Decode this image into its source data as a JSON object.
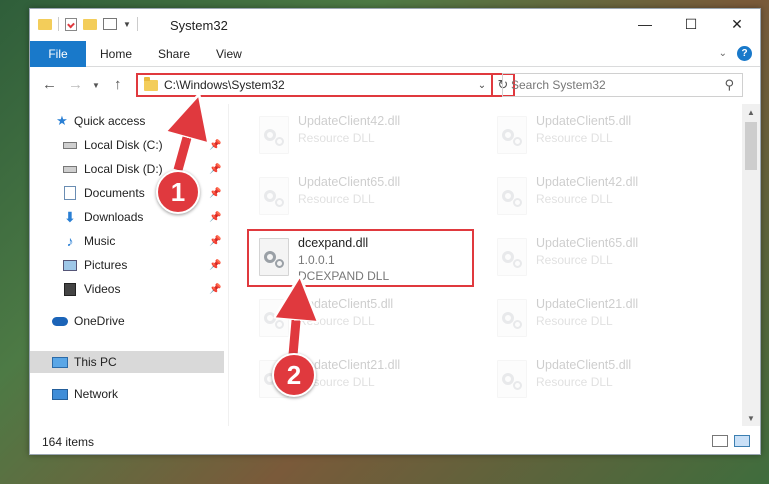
{
  "window": {
    "title": "System32",
    "controls": {
      "minimize": "—",
      "maximize": "☐",
      "close": "✕"
    }
  },
  "ribbon": {
    "tabs": [
      "File",
      "Home",
      "Share",
      "View"
    ]
  },
  "navigation": {
    "address": "C:\\Windows\\System32",
    "search_placeholder": "Search System32"
  },
  "sidebar": {
    "items": [
      {
        "label": "Quick access",
        "icon": "star-icon",
        "pinned": false
      },
      {
        "label": "Local Disk (C:)",
        "icon": "drive-icon",
        "pinned": true
      },
      {
        "label": "Local Disk (D:)",
        "icon": "drive-icon",
        "pinned": true
      },
      {
        "label": "Documents",
        "icon": "documents-icon",
        "pinned": true
      },
      {
        "label": "Downloads",
        "icon": "download-icon",
        "pinned": true
      },
      {
        "label": "Music",
        "icon": "music-icon",
        "pinned": true
      },
      {
        "label": "Pictures",
        "icon": "pictures-icon",
        "pinned": true
      },
      {
        "label": "Videos",
        "icon": "videos-icon",
        "pinned": true
      },
      {
        "label": "OneDrive",
        "icon": "cloud-icon",
        "pinned": false
      },
      {
        "label": "This PC",
        "icon": "computer-icon",
        "pinned": false,
        "selected": true
      },
      {
        "label": "Network",
        "icon": "network-icon",
        "pinned": false
      }
    ]
  },
  "files": [
    {
      "name": "UpdateClient42.dll",
      "type": "Resource DLL",
      "faded": true
    },
    {
      "name": "UpdateClient5.dll",
      "type": "Resource DLL",
      "faded": true
    },
    {
      "name": "UpdateClient65.dll",
      "type": "Resource DLL",
      "faded": true
    },
    {
      "name": "UpdateClient42.dll",
      "type": "Resource DLL",
      "faded": true
    },
    {
      "name": "dcexpand.dll",
      "version": "1.0.0.1",
      "type": "DCEXPAND DLL",
      "faded": false
    },
    {
      "name": "UpdateClient65.dll",
      "type": "Resource DLL",
      "faded": true
    },
    {
      "name": "UpdateClient5.dll",
      "type": "Resource DLL",
      "faded": true
    },
    {
      "name": "UpdateClient21.dll",
      "type": "Resource DLL",
      "faded": true
    },
    {
      "name": "UpdateClient21.dll",
      "type": "Resource DLL",
      "faded": true
    },
    {
      "name": "UpdateClient5.dll",
      "type": "Resource DLL",
      "faded": true
    }
  ],
  "status": {
    "item_count": "164 items"
  },
  "annotations": {
    "step1": "1",
    "step2": "2",
    "color": "#e0393e"
  }
}
